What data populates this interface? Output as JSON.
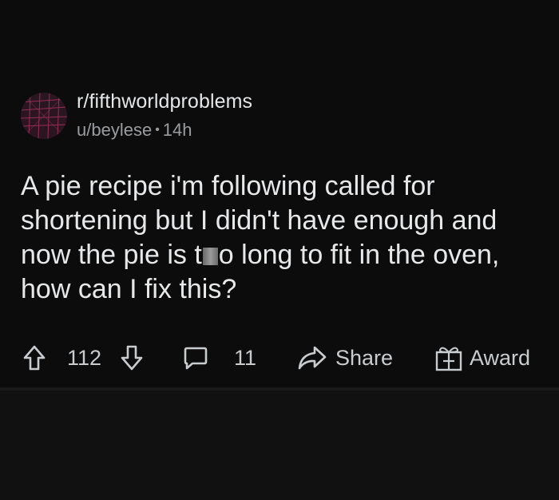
{
  "post": {
    "subreddit": "r/fifthworldproblems",
    "author": "u/beylese",
    "separator": "•",
    "age": "14h",
    "title_part1": "A pie recipe i'm following called for shortening but I didn't have enough and now the pie is t",
    "title_part2": "o long to fit in the oven, how can I fix this?"
  },
  "actions": {
    "score": "112",
    "comments": "11",
    "share_label": "Share",
    "award_label": "Award"
  },
  "icons": {
    "upvote": "arrow-up-icon",
    "downvote": "arrow-down-icon",
    "comment": "comment-bubble-icon",
    "share": "share-arrow-icon",
    "award": "gift-icon"
  },
  "colors": {
    "background": "#0c0c0c",
    "text": "#d7dadc",
    "meta": "#9a9da0"
  }
}
